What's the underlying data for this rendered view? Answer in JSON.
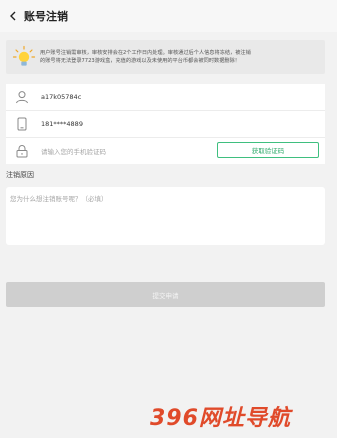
{
  "header": {
    "title": "账号注销"
  },
  "notice": {
    "line1": "用户账号注销需审核，审核安排会在2个工作日内处理。审核通过后个人信息将冻结，被注销",
    "line2": "的账号将无法登录7723游戏盒，充值的游戏以及未使用的平台币都会被同时数据删除！"
  },
  "form": {
    "account": "a17k05784c",
    "phone": "181****4889",
    "code_placeholder": "请输入您的手机验证码",
    "code_button": "获取验证码"
  },
  "reason": {
    "label": "注销原因",
    "placeholder": "您为什么想注销账号呢？（必填）"
  },
  "submit_label": "提交申请",
  "watermark": "396网址导航",
  "colors": {
    "accent": "#2eaa6a",
    "watermark": "#e04a2a",
    "button_disabled": "#cfcfcf"
  }
}
